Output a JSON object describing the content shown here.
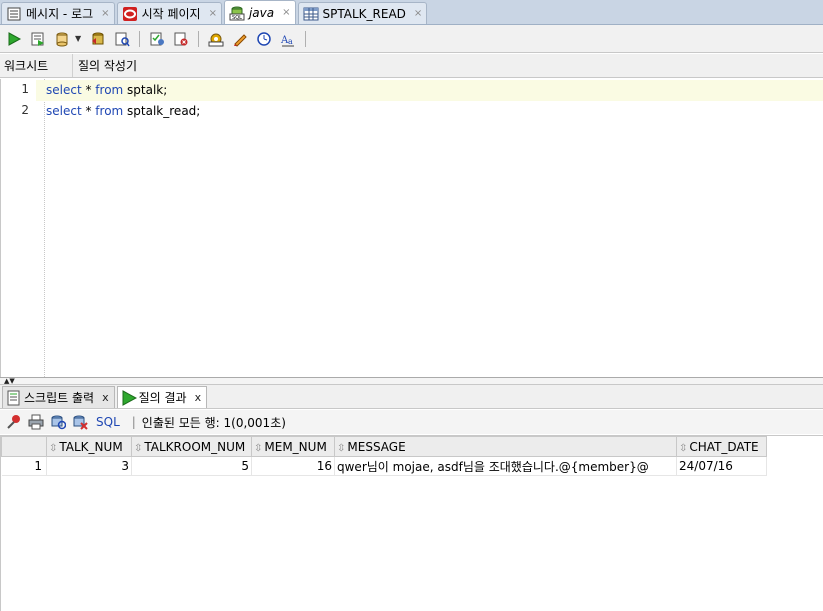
{
  "doc_tabs": [
    {
      "label": "메시지 - 로그",
      "close": "×"
    },
    {
      "label": "시작 페이지",
      "close": "×"
    },
    {
      "label": "java",
      "close": "×"
    },
    {
      "label": "SPTALK_READ",
      "close": "×"
    }
  ],
  "worksheet_tabs": [
    "워크시트",
    "질의 작성기"
  ],
  "editor": {
    "lines": [
      {
        "num": "1",
        "kw1": "select",
        "rest1": " * ",
        "kw2": "from",
        "rest2": " sptalk;"
      },
      {
        "num": "2",
        "kw1": "select",
        "rest1": " * ",
        "kw2": "from",
        "rest2": " sptalk_read;"
      }
    ]
  },
  "output_tabs": [
    {
      "label": "스크립트 출력",
      "close": "x"
    },
    {
      "label": "질의 결과",
      "close": "x"
    }
  ],
  "result_toolbar": {
    "sql_label": "SQL",
    "separator": "|",
    "status": "인출된 모든 행: 1(0,001초)"
  },
  "grid": {
    "columns": [
      "TALK_NUM",
      "TALKROOM_NUM",
      "MEM_NUM",
      "MESSAGE",
      "CHAT_DATE"
    ],
    "rows": [
      {
        "row_num": "1",
        "cells": [
          "3",
          "5",
          "16",
          "qwer님이 mojae, asdf님을 조대했습니다.@{member}@",
          "24/07/16"
        ]
      }
    ]
  },
  "colors": {
    "keyword": "#1f47b3",
    "current_line": "#fafbe3",
    "tab_bar": "#c9d5e4"
  }
}
